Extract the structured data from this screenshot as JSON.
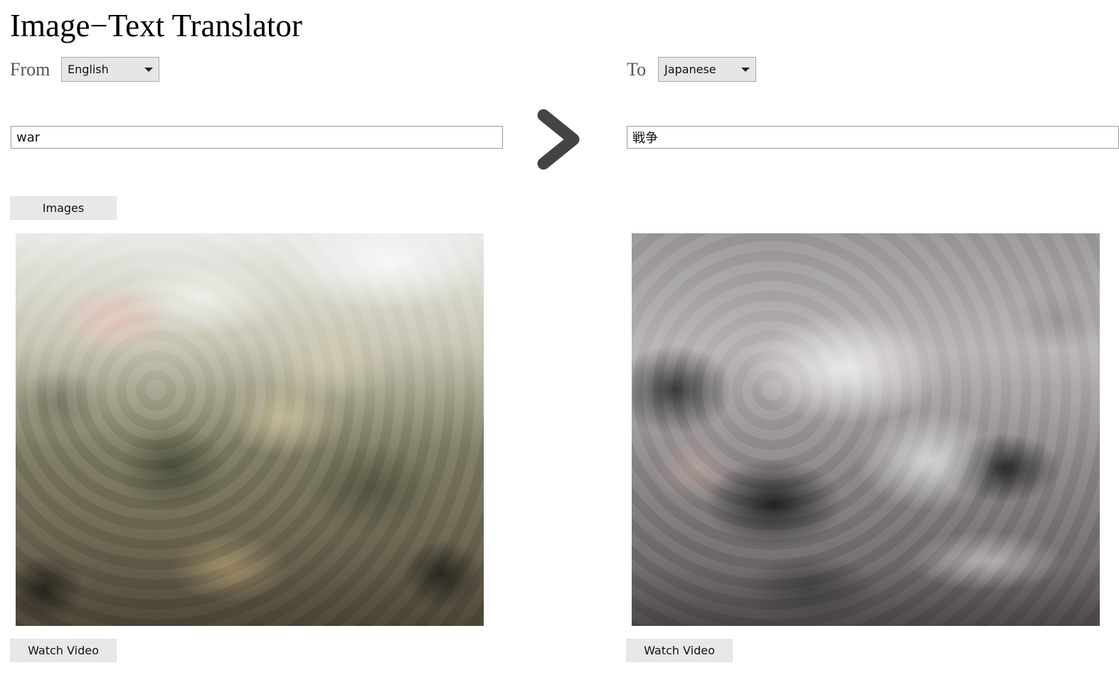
{
  "app": {
    "title": "Image−Text Translator"
  },
  "from": {
    "label": "From",
    "language": "English"
  },
  "to": {
    "label": "To",
    "language": "Japanese"
  },
  "input": {
    "source_text": "war",
    "translated_text": "戦争"
  },
  "buttons": {
    "images": "Images",
    "watch_video_left": "Watch Video",
    "watch_video_right": "Watch Video"
  },
  "icons": {
    "translate_arrow": "chevron-right-icon",
    "select_caret": "caret-down-icon"
  },
  "colors": {
    "arrow": "#444444",
    "button_bg": "#e8e8e8"
  }
}
